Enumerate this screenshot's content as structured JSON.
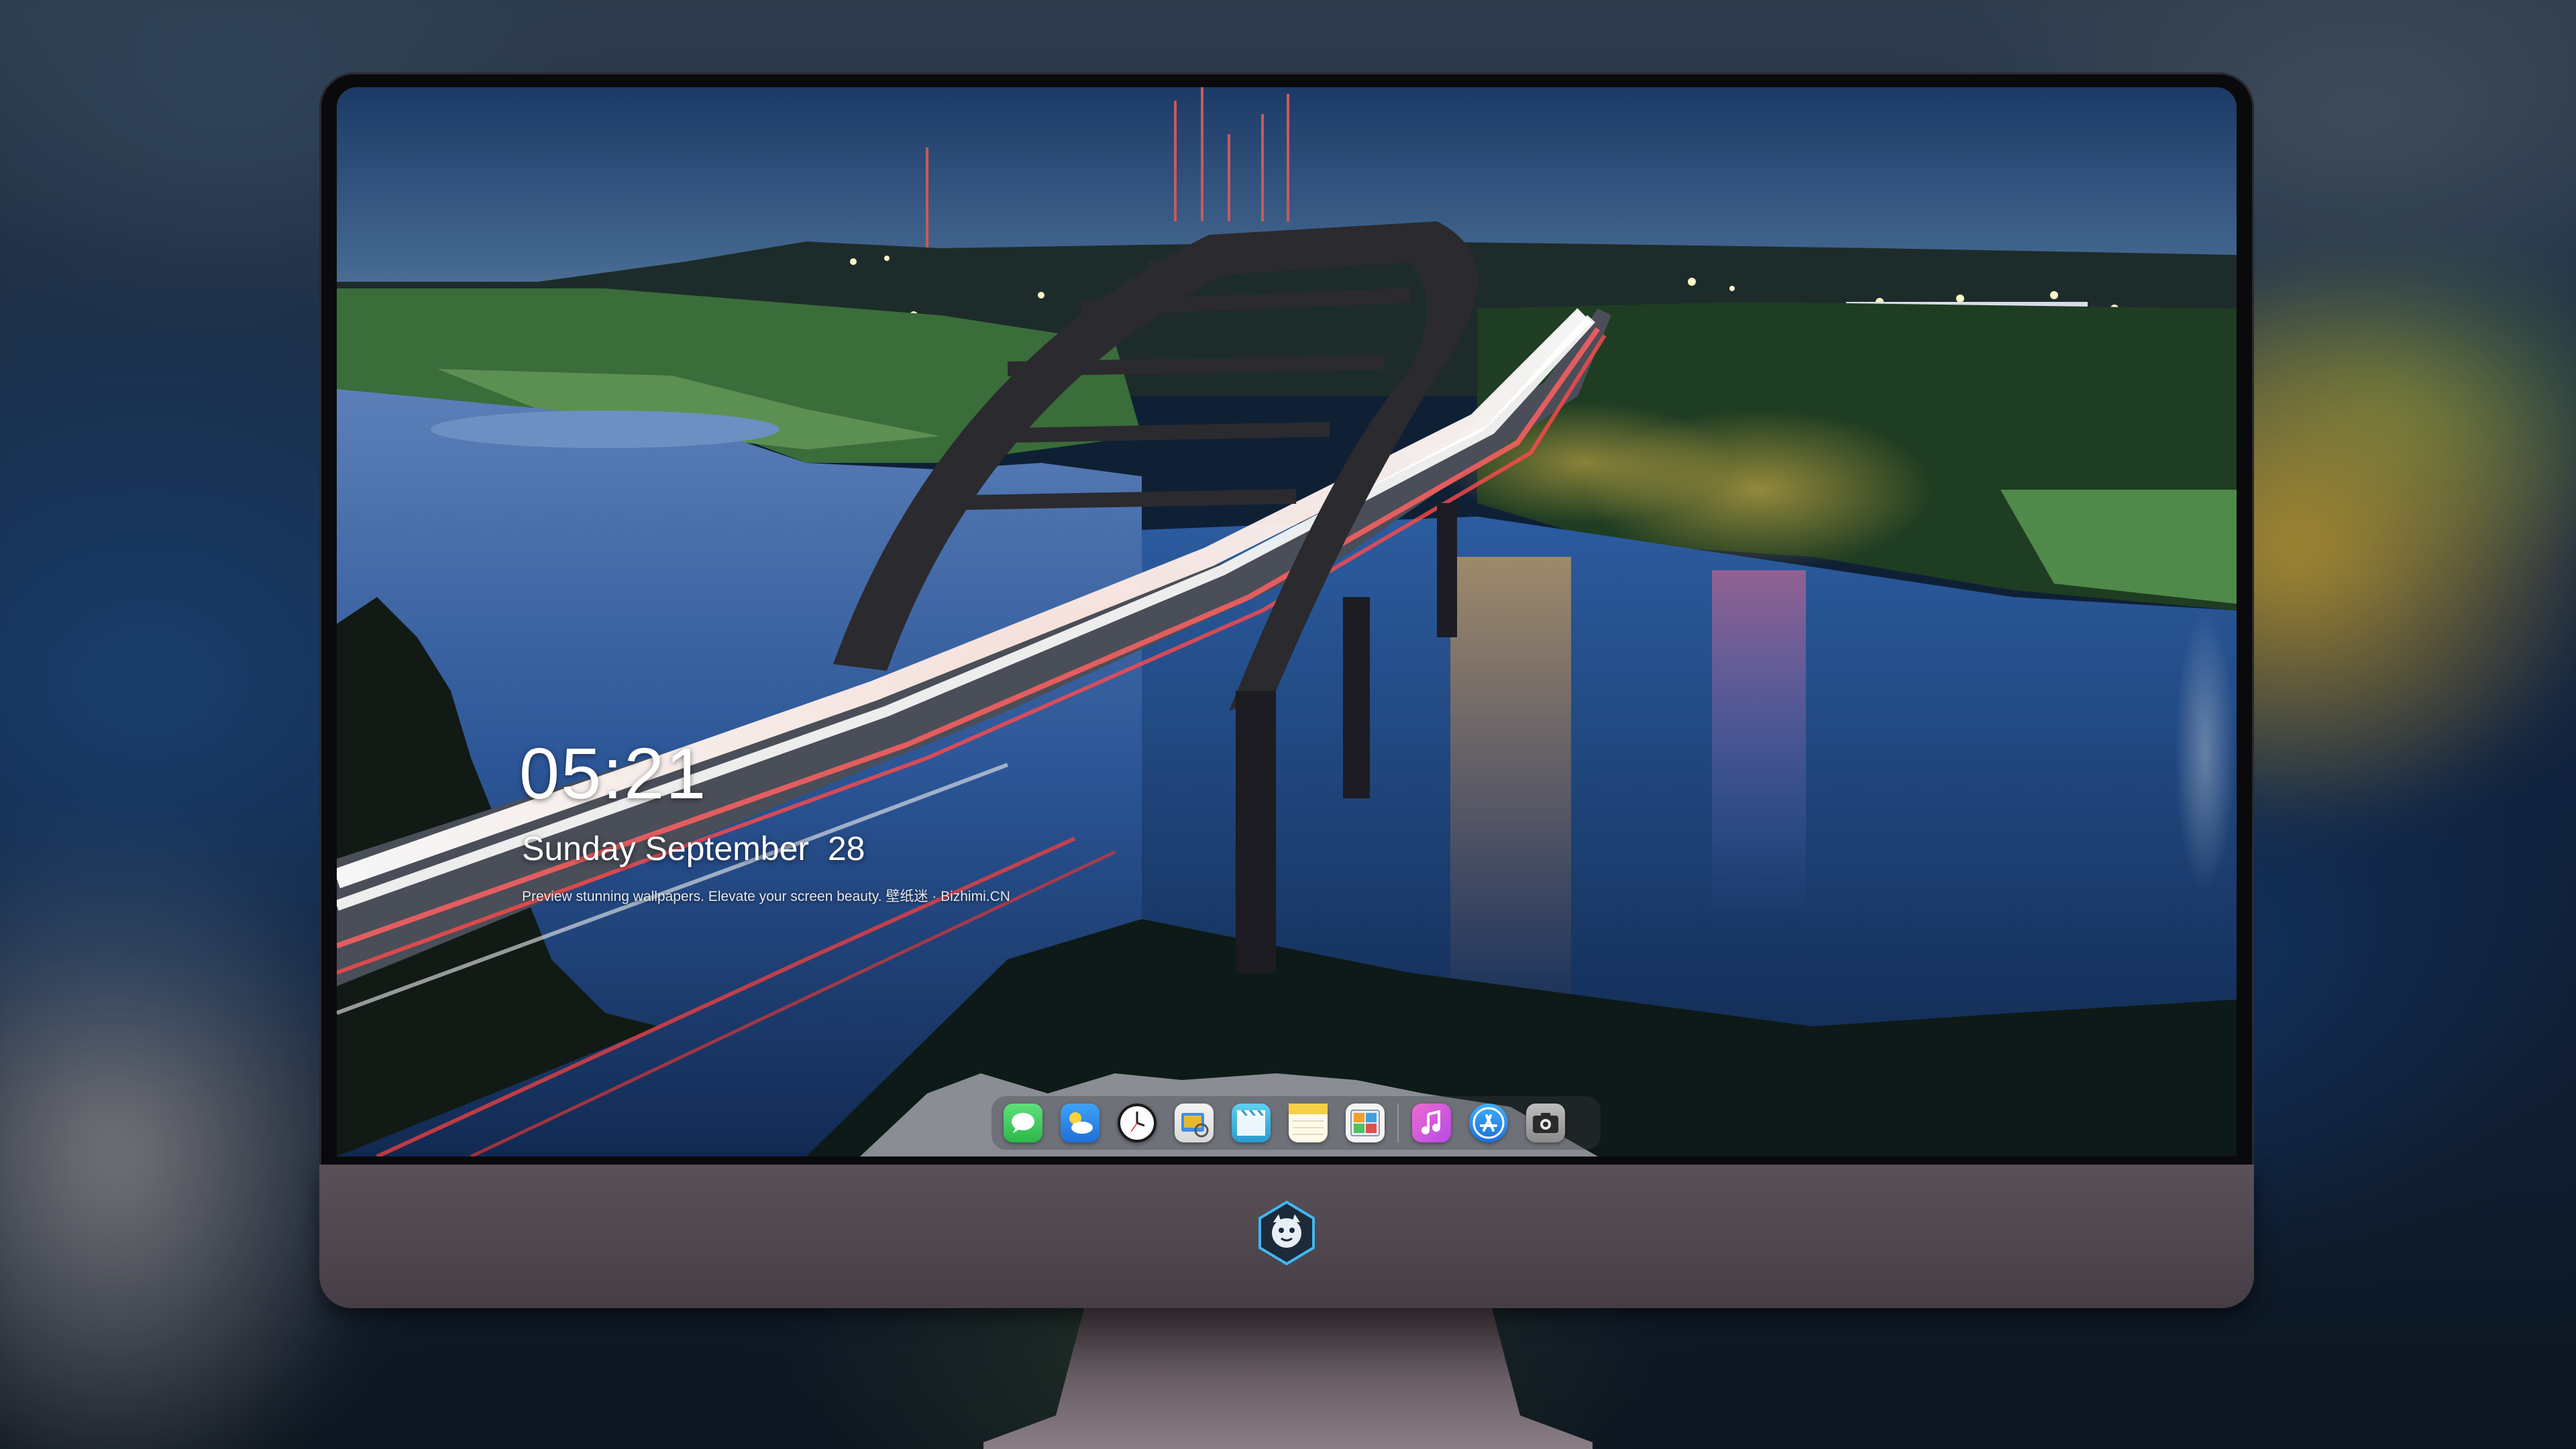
{
  "lockscreen": {
    "time": "05:21",
    "date": "Sunday September  28",
    "caption": "Preview stunning wallpapers. Elevate your screen beauty. 壁纸迷 · Bizhimi.CN"
  },
  "dock": {
    "icons": [
      {
        "name": "messages-icon",
        "color": "#34c759"
      },
      {
        "name": "weather-icon",
        "color": "#2f8ff0"
      },
      {
        "name": "clock-icon",
        "color": "#ffffff"
      },
      {
        "name": "preview-icon",
        "color": "#e8b830"
      },
      {
        "name": "clips-icon",
        "color": "#3ab0e0"
      },
      {
        "name": "notes-icon",
        "color": "#f7d046"
      },
      {
        "name": "photos-icon",
        "color": "#f0f0f0"
      },
      {
        "name": "itunes-icon",
        "color": "#e05ad8"
      },
      {
        "name": "app-store-icon",
        "color": "#2a8ef0"
      },
      {
        "name": "camera-icon",
        "color": "#9a9a9a"
      }
    ]
  },
  "colors": {
    "bezel": "#0a0a0c",
    "chin": "#4e464e",
    "screen_sky": "#1a3558",
    "water": "#1c3d70"
  }
}
